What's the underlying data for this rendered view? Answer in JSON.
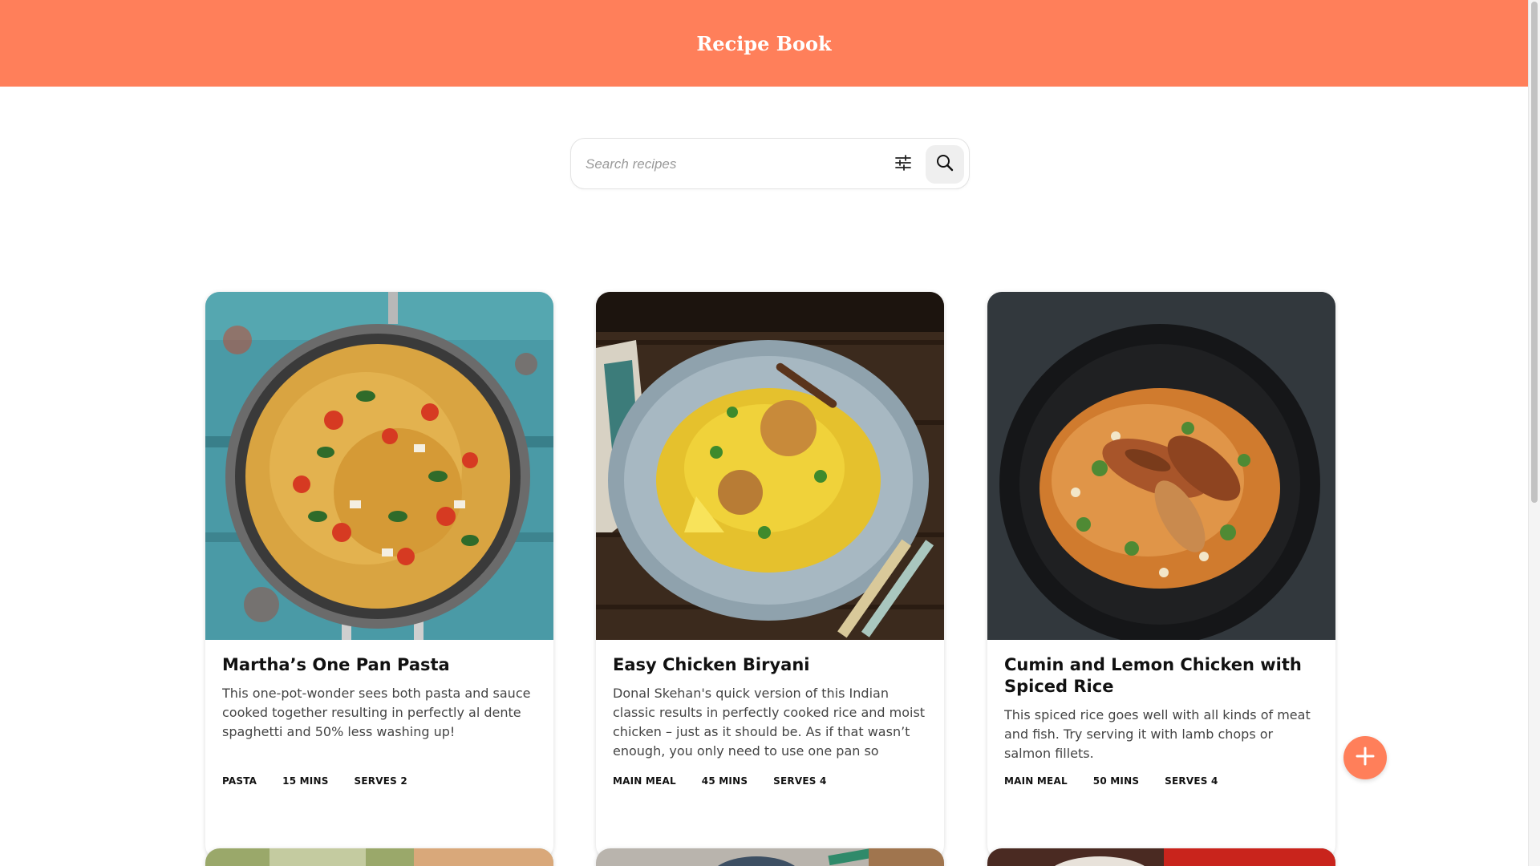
{
  "header": {
    "title": "Recipe Book"
  },
  "search": {
    "placeholder": "Search recipes",
    "filter_icon": "sliders-icon",
    "search_icon": "search-icon"
  },
  "recipes": [
    {
      "title": "Martha’s One Pan Pasta",
      "description": "This one-pot-wonder sees both pasta and sauce cooked together resulting in perfectly al dente spaghetti and 50% less washing up!",
      "tags": [
        "PASTA",
        "15 MINS",
        "SERVES 2"
      ]
    },
    {
      "title": "Easy Chicken Biryani",
      "description": "Donal Skehan's quick version of this Indian classic results in perfectly cooked rice and moist chicken – just as it should be. As if that wasn’t enough, you only need to use one pan so there’…",
      "tags": [
        "MAIN MEAL",
        "45 MINS",
        "SERVES 4"
      ]
    },
    {
      "title": "Cumin and Lemon Chicken with Spiced Rice",
      "description": "This spiced rice goes well with all kinds of meat and fish. Try serving it with lamb chops or salmon fillets.",
      "tags": [
        "MAIN MEAL",
        "50 MINS",
        "SERVES 4"
      ]
    }
  ],
  "fab": {
    "icon": "plus-icon"
  },
  "colors": {
    "accent": "#ff7f5a"
  }
}
